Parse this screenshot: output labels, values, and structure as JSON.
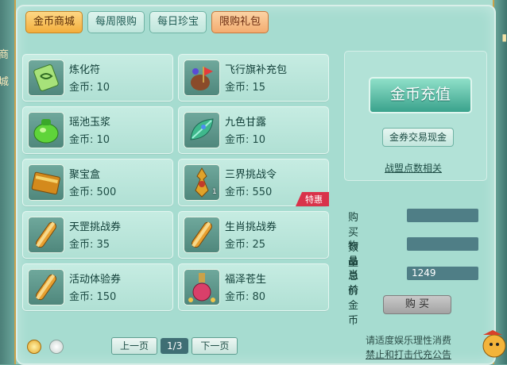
{
  "side_left": {
    "glyphs": [
      "商",
      "城"
    ]
  },
  "tabs": [
    {
      "label": "金币商城",
      "active": true
    },
    {
      "label": "每周限购",
      "active": false
    },
    {
      "label": "每日珍宝",
      "active": false
    },
    {
      "label": "限购礼包",
      "active": false
    }
  ],
  "items": [
    {
      "name": "炼化符",
      "price": "金币: 10",
      "icon": "talisman-icon"
    },
    {
      "name": "飞行旗补充包",
      "price": "金币: 15",
      "icon": "flag-pack-icon"
    },
    {
      "name": "瑶池玉浆",
      "price": "金币: 10",
      "icon": "jade-pot-icon"
    },
    {
      "name": "九色甘露",
      "price": "金币: 10",
      "icon": "dew-leaf-icon"
    },
    {
      "name": "聚宝盒",
      "price": "金币: 500",
      "icon": "treasure-box-icon"
    },
    {
      "name": "三界挑战令",
      "price": "金币: 550",
      "icon": "challenge-token-icon",
      "count": "1",
      "badge": "特惠"
    },
    {
      "name": "天罡挑战券",
      "price": "金币: 35",
      "icon": "scroll-icon"
    },
    {
      "name": "生肖挑战券",
      "price": "金币: 25",
      "icon": "scroll-icon"
    },
    {
      "name": "活动体验券",
      "price": "金币: 150",
      "icon": "scroll-icon"
    },
    {
      "name": "福泽苍生",
      "price": "金币: 80",
      "icon": "potion-icon"
    }
  ],
  "panel": {
    "recharge_label": "金币充值",
    "exchange_label": "金券交易现金",
    "points_link": "战盟点数相关"
  },
  "form": {
    "qty_label": "购买数量",
    "qty_value": "",
    "total_label": "物品总价",
    "total_value": "",
    "current_label": "当前金币",
    "current_value": "1249",
    "buy_label": "购 买"
  },
  "pager": {
    "prev": "上一页",
    "page": "1/3",
    "next": "下一页"
  },
  "notice": {
    "line1": "请适度娱乐理性消费",
    "line2": "禁止和打击代充公告"
  },
  "colors": {
    "accent_tab": "#f3ae3c",
    "recharge": "#3aa28c",
    "badge": "#d9324a"
  }
}
